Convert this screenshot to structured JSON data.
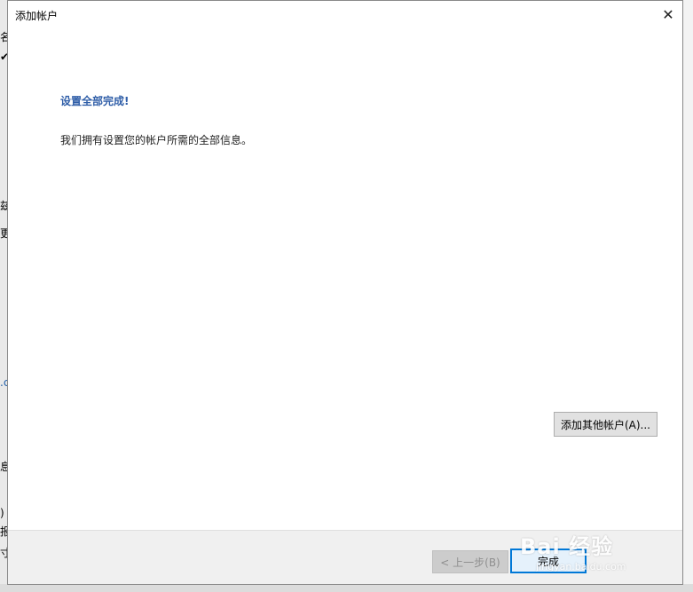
{
  "dialog": {
    "title": "添加帐户",
    "close_glyph": "✕",
    "heading": "设置全部完成!",
    "message": "我们拥有设置您的帐户所需的全部信息。",
    "add_other_label": "添加其他帐户(A)...",
    "back_label": "< 上一步(B)",
    "finish_label": "完成"
  },
  "background": {
    "left_fragments": [
      "名",
      "✔",
      "兹",
      "更",
      ".c",
      "息",
      ")",
      "报",
      "寸"
    ]
  },
  "watermark": {
    "brand": "Bai 经验",
    "url": "jingyan.baidu.com"
  }
}
